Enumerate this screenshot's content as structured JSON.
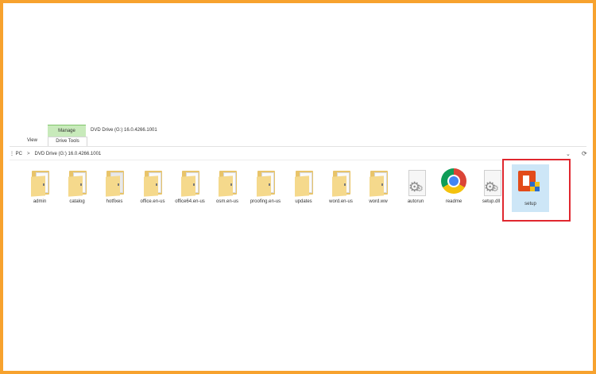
{
  "ribbon": {
    "context_group_label": "Manage",
    "window_title": "DVD Drive (G:) 16.0.4266.1001",
    "tabs": [
      "View",
      "Drive Tools"
    ]
  },
  "address_bar": {
    "segments": [
      "⋮ PC",
      "DVD Drive (G:) 16.0.4266.1001"
    ],
    "separator": ">"
  },
  "items": [
    {
      "label": "admin",
      "kind": "folder"
    },
    {
      "label": "catalog",
      "kind": "folder"
    },
    {
      "label": "hotfixes",
      "kind": "folder"
    },
    {
      "label": "office.en-us",
      "kind": "folder"
    },
    {
      "label": "office64.en-us",
      "kind": "folder"
    },
    {
      "label": "osm.en-us",
      "kind": "folder"
    },
    {
      "label": "proofing.en-us",
      "kind": "folder"
    },
    {
      "label": "updates",
      "kind": "folder"
    },
    {
      "label": "word.en-us",
      "kind": "folder"
    },
    {
      "label": "word.ww",
      "kind": "folder"
    },
    {
      "label": "autorun",
      "kind": "settings-file"
    },
    {
      "label": "readme",
      "kind": "chrome"
    },
    {
      "label": "setup.dll",
      "kind": "settings-file"
    },
    {
      "label": "setup",
      "kind": "office-installer",
      "selected": true
    }
  ],
  "colors": {
    "frame_border": "#f7a22e",
    "highlight_box": "#e0272f",
    "selection_bg": "#cde6f7",
    "manage_tab_bg": "#c8eabb"
  }
}
